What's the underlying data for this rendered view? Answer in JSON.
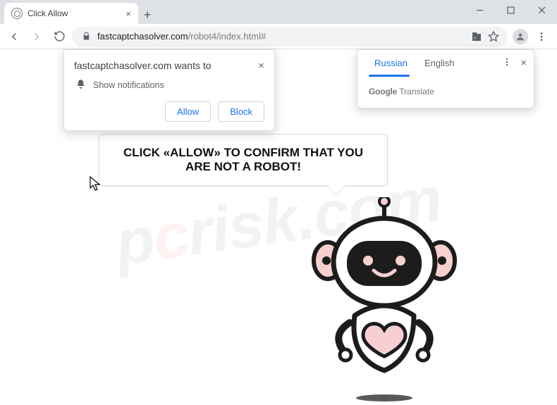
{
  "window": {
    "tab_title": "Click Allow"
  },
  "toolbar": {
    "url_host": "fastcaptchasolver.com",
    "url_path": "/robot4/index.html#"
  },
  "permission_prompt": {
    "origin": "fastcaptchasolver.com wants to",
    "request": "Show notifications",
    "allow": "Allow",
    "block": "Block"
  },
  "translate_popup": {
    "tab_active": "Russian",
    "tab_other": "English",
    "brand_bold": "Google",
    "brand_light": " Translate"
  },
  "page": {
    "bubble_text": "CLICK «ALLOW» TO CONFIRM THAT YOU ARE NOT A ROBOT!"
  },
  "watermark": {
    "p": "p",
    "c": "c",
    "rest": "risk.com"
  }
}
